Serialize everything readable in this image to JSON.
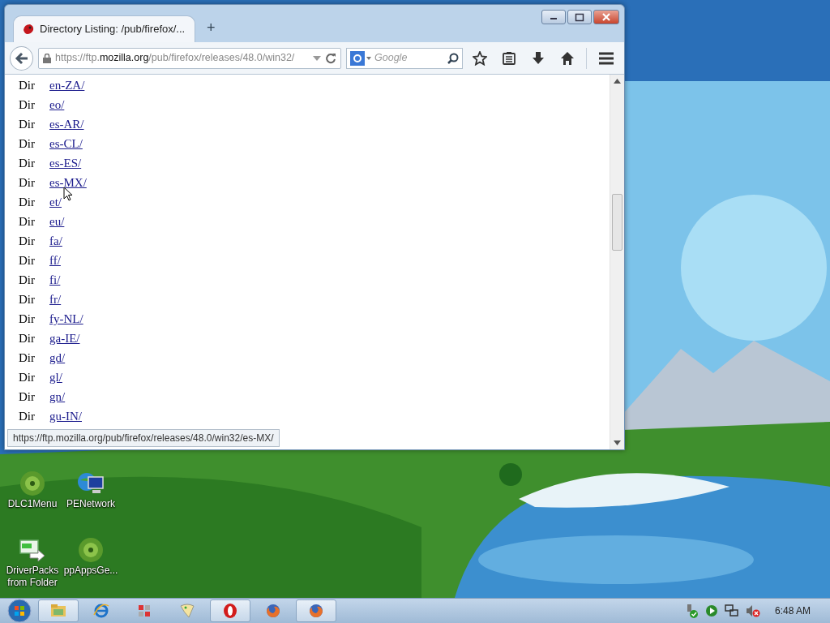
{
  "browser": {
    "tab_title": "Directory Listing: /pub/firefox/...",
    "new_tab": "+",
    "url": {
      "scheme": "https://ftp.",
      "domain": "mozilla.org",
      "path": "/pub/firefox/releases/48.0/win32/"
    },
    "search": {
      "placeholder": "Google"
    },
    "entries": [
      {
        "type": "Dir",
        "name": "en-ZA/"
      },
      {
        "type": "Dir",
        "name": "eo/"
      },
      {
        "type": "Dir",
        "name": "es-AR/"
      },
      {
        "type": "Dir",
        "name": "es-CL/"
      },
      {
        "type": "Dir",
        "name": "es-ES/"
      },
      {
        "type": "Dir",
        "name": "es-MX/"
      },
      {
        "type": "Dir",
        "name": "et/"
      },
      {
        "type": "Dir",
        "name": "eu/"
      },
      {
        "type": "Dir",
        "name": "fa/"
      },
      {
        "type": "Dir",
        "name": "ff/"
      },
      {
        "type": "Dir",
        "name": "fi/"
      },
      {
        "type": "Dir",
        "name": "fr/"
      },
      {
        "type": "Dir",
        "name": "fy-NL/"
      },
      {
        "type": "Dir",
        "name": "ga-IE/"
      },
      {
        "type": "Dir",
        "name": "gd/"
      },
      {
        "type": "Dir",
        "name": "gl/"
      },
      {
        "type": "Dir",
        "name": "gn/"
      },
      {
        "type": "Dir",
        "name": "gu-IN/"
      }
    ],
    "status_url": "https://ftp.mozilla.org/pub/firefox/releases/48.0/win32/es-MX/"
  },
  "desktop_icons": [
    {
      "label": "DLC1Menu",
      "kind": "disc"
    },
    {
      "label": "PENetwork",
      "kind": "network"
    },
    {
      "label": "DriverPacks from Folder",
      "kind": "driver"
    },
    {
      "label": "ppAppsGe...",
      "kind": "disc"
    }
  ],
  "taskbar": {
    "items": [
      {
        "kind": "folder",
        "open": true
      },
      {
        "kind": "ie",
        "open": false
      },
      {
        "kind": "grid",
        "open": false
      },
      {
        "kind": "paint",
        "open": false
      },
      {
        "kind": "opera",
        "open": true
      },
      {
        "kind": "firefox",
        "open": false
      },
      {
        "kind": "firefox",
        "open": true
      }
    ],
    "clock": "6:48 AM"
  }
}
